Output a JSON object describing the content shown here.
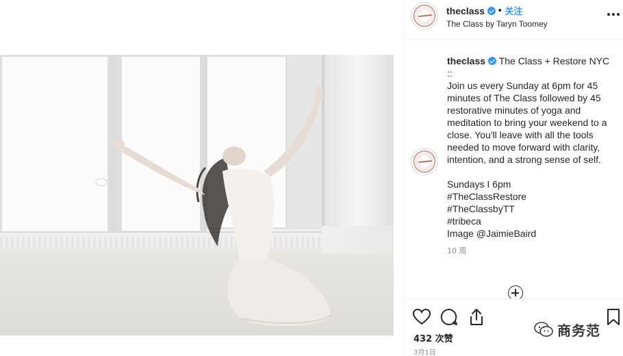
{
  "post": {
    "image_alt": "Woman in white kneeling on a studio floor with arms raised, head tilted back",
    "account": {
      "username": "theclass",
      "verified": true,
      "follow_label": "关注",
      "subtitle": "The Class by Taryn Toomey"
    },
    "caption": {
      "username": "theclass",
      "title": "The Class + Restore NYC",
      "separator": "::",
      "body": "Join us every Sunday at 6pm for 45 minutes of The Class followed by 45 restorative minutes of yoga and meditation to bring your weekend to a close. You'll leave with all the tools needed to move forward with clarity, intention, and a strong sense of self.",
      "schedule": "Sundays I 6pm",
      "hashtags": [
        "#TheClassRestore",
        "#TheClassbyTT",
        "#tribeca"
      ],
      "credit": "Image @JaimieBaird",
      "time_ago": "10 周"
    },
    "likes_label": "432 次赞",
    "date_label": "3月1日"
  },
  "icons": {
    "more": "more-options-icon",
    "like": "heart-icon",
    "comment": "comment-bubble-icon",
    "share": "share-icon",
    "save": "bookmark-icon",
    "load_more": "plus-circle-icon"
  },
  "watermark": {
    "text": "商务范"
  },
  "colors": {
    "link_blue": "#3897f0",
    "text": "#262626",
    "muted": "#8e8e8e",
    "verified": "#3897f0"
  }
}
